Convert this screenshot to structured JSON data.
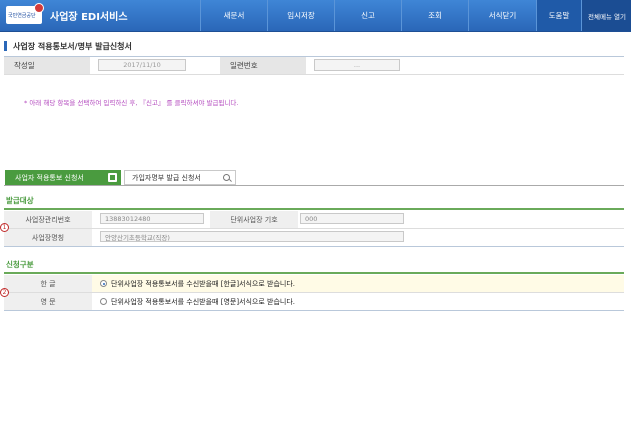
{
  "header": {
    "logo_text": "국민연금공단",
    "app_title": "사업장 EDI서비스",
    "nav": [
      "새문서",
      "임시저장",
      "신고",
      "조회",
      "서식닫기"
    ],
    "help_label": "도움말",
    "all_menu_label": "전체메뉴 열기"
  },
  "page": {
    "title": "사업장 적용통보서/명부 발급신청서"
  },
  "meta": {
    "date_label": "작성일",
    "date_value": "2017/11/10",
    "serial_label": "일련번호",
    "serial_value": "..."
  },
  "notice": "* 아래 해당 항목을 선택하여 입력하신 후, 『신고』 를 클릭하셔야 발급됩니다.",
  "tabs": [
    {
      "label": "사업자 적용통보 신청서",
      "active": true
    },
    {
      "label": "가입자명부 발급 신청서",
      "active": false
    }
  ],
  "issue_target": {
    "section_title": "발급대상",
    "marker": "1",
    "mgmt_no_label": "사업장관리번호",
    "mgmt_no_value": "13883012480",
    "unit_code_label": "단위사업장 기호",
    "unit_code_value": "000",
    "name_label": "사업장명칭",
    "name_value": "안양산기초등학교(직장)"
  },
  "request_type": {
    "section_title": "신청구분",
    "marker": "2",
    "options": [
      {
        "label": "한 글",
        "text": "단위사업장 적용통보서를 수신받을때 [한글]서식으로 받습니다.",
        "checked": true
      },
      {
        "label": "영 문",
        "text": "단위사업장 적용통보서를 수신받을때 [영문]서식으로 받습니다.",
        "checked": false
      }
    ]
  },
  "colors": {
    "header_blue": "#2a67b8",
    "accent_green": "#4a9b3f",
    "notice_purple": "#b44bbf",
    "marker_red": "#c02a2a"
  }
}
